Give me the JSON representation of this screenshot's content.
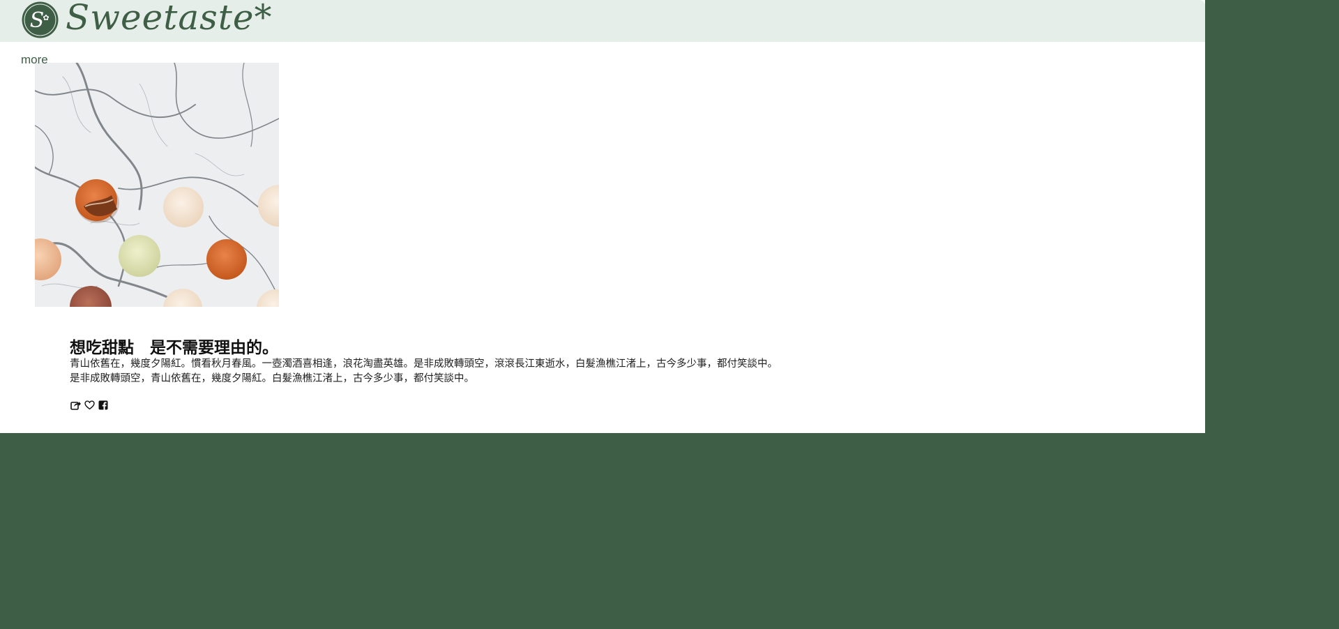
{
  "header": {
    "brand_name": "Sweetaste*",
    "logo_letter": "S",
    "logo_icon": "sweetaste-logo-icon"
  },
  "nav": {
    "more_label": "more"
  },
  "article": {
    "hero_image": "macarons-on-marble-image",
    "title": "想吃甜點　是不需要理由的。",
    "body_lines": [
      "青山依舊在，幾度夕陽紅。慣看秋月春風。一壺濁酒喜相逢，浪花淘盡英雄。是非成敗轉頭空，滾滾長江東逝水，白髮漁樵江渚上，古今多少事，都付笑談中。",
      "是非成敗轉頭空，青山依舊在，幾度夕陽紅。白髮漁樵江渚上，古今多少事，都付笑談中。"
    ],
    "actions": [
      {
        "icon": "share-icon"
      },
      {
        "icon": "heart-icon"
      },
      {
        "icon": "facebook-icon"
      }
    ]
  },
  "colors": {
    "brand_green": "#3f5e46",
    "header_bg": "#e6eee9",
    "page_bg": "#ffffff",
    "macaron_orange": "#d9692a",
    "macaron_cream": "#f4e3cf",
    "macaron_pistachio": "#dfe3b4",
    "macaron_peach": "#f1c19c",
    "macaron_brown": "#a25a44"
  }
}
